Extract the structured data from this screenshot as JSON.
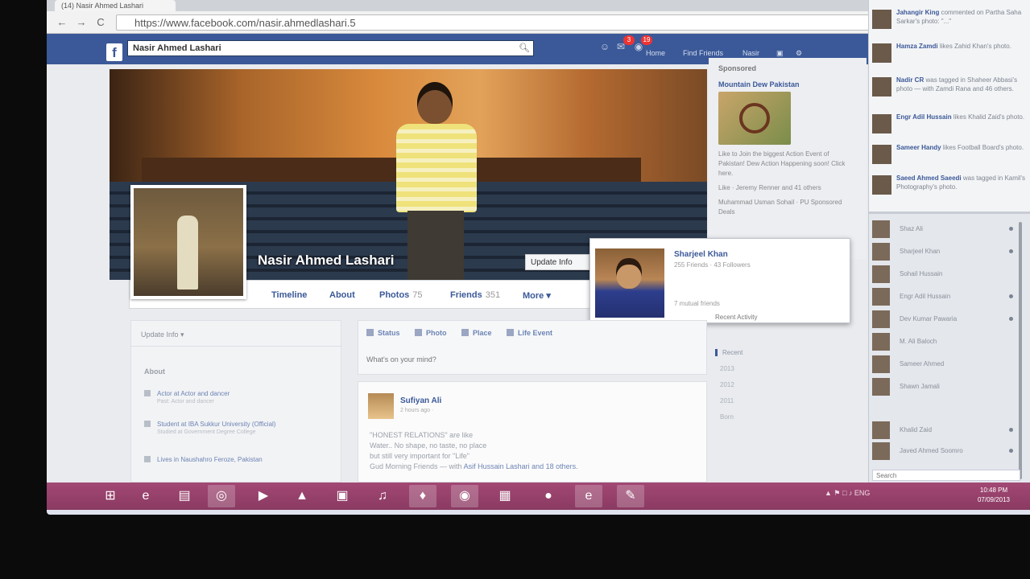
{
  "browser": {
    "tab_title": "(14) Nasir Ahmed Lashari",
    "url": "https://www.facebook.com/nasir.ahmedlashari.5",
    "back": "←",
    "forward": "→",
    "reload": "C"
  },
  "fb_header": {
    "logo": "f",
    "search_value": "Nasir Ahmed Lashari",
    "search_icon": "search-icon",
    "notifications": [
      {
        "icon": "friend-requests-icon",
        "badge": ""
      },
      {
        "icon": "messages-icon",
        "badge": "3"
      },
      {
        "icon": "notifications-icon",
        "badge": "19"
      }
    ],
    "nav": [
      "Home",
      "Find Friends",
      "Nasir"
    ]
  },
  "profile": {
    "name": "Nasir Ahmed Lashari",
    "update_info_label": "Update Info",
    "tabs": [
      {
        "label": "Timeline",
        "count": ""
      },
      {
        "label": "About",
        "count": ""
      },
      {
        "label": "Photos",
        "count": "75"
      },
      {
        "label": "Friends",
        "count": "351"
      },
      {
        "label": "More ▾",
        "count": ""
      }
    ]
  },
  "sponsored": {
    "header": "Sponsored",
    "ad_title": "Mountain Dew Pakistan",
    "ad_desc": "Like to Join the biggest Action Event of Pakistan! Dew Action Happening soon! Click here.",
    "likes": "Like · Jeremy Renner and 41 others",
    "extra": "Muhammad Usman Sohail · PU Sponsored Deals"
  },
  "hovercard": {
    "name": "Sharjeel Khan",
    "sub": "255 Friends · 43 Followers",
    "mutual": "7 mutual friends"
  },
  "left_col": {
    "update_info": "Update Info ▾",
    "about_title": "About",
    "items": [
      {
        "label": "Actor at Actor and dancer",
        "sub": "Past: Actor and dancer"
      },
      {
        "label": "Student at IBA Sukkur University (Official)",
        "sub": "Studied at Government Degree College"
      },
      {
        "label": "Lives in Naushahro Feroze, Pakistan",
        "sub": ""
      }
    ]
  },
  "composer": {
    "tabs": [
      "Status",
      "Photo",
      "Place",
      "Life Event"
    ],
    "placeholder": "What's on your mind?"
  },
  "post": {
    "author": "Sufiyan Ali",
    "time": "2 hours ago · ",
    "line1": "\"HONEST RELATIONS\" are like",
    "line2": "Water.. No shape, no taste, no place",
    "line3": "but still very important for \"Life\"",
    "line4_prefix": "Gud Morning Friends — with ",
    "line4_link": "Asif Hussain Lashari and 18 others."
  },
  "years": {
    "note": "Recent Activity",
    "list": [
      "Recent",
      "2013",
      "2012",
      "2011",
      "Born"
    ]
  },
  "ticker": [
    {
      "actor": "Jahangir King",
      "text": "commented on Partha Saha Sarkar's photo: \"...\""
    },
    {
      "actor": "Hamza Zamdi",
      "text": "likes Zahid Khan's photo."
    },
    {
      "actor": "Nadir CR",
      "text": "was tagged in Shaheer Abbasi's photo — with Zamdi Rana and 46 others."
    },
    {
      "actor": "Engr Adil Hussain",
      "text": "likes Khalid Zaid's photo."
    },
    {
      "actor": "Sameer Handy",
      "text": "likes Football Board's photo."
    },
    {
      "actor": "Saeed Ahmed Saeedi",
      "text": "was tagged in Kamil's Photography's photo."
    }
  ],
  "chat": {
    "friends": [
      "Shaz Ali",
      "Sharjeel Khan",
      "Sohail Hussain",
      "Engr Adil Hussain",
      "Dev Kumar Pawaria",
      "M. Ali Baloch",
      "Sameer Ahmed",
      "Shawn Jamali",
      "Khalid Zaid",
      "Javed Ahmed Soomro"
    ],
    "search_placeholder": "Search"
  },
  "taskbar": {
    "apps": [
      "windows-logo-icon",
      "internet-explorer-icon",
      "file-explorer-icon",
      "disc-icon",
      "media-icon",
      "vlc-icon",
      "network-icon",
      "itunes-icon",
      "game-icon",
      "chrome-icon",
      "office-icon",
      "app-icon",
      "browser-icon",
      "paint-icon"
    ],
    "tray": "ENG",
    "time": "10:48 PM",
    "date": "07/09/2013"
  },
  "colors": {
    "facebook_blue": "#3b5998",
    "taskbar": "#8a3a62",
    "badge_red": "#e33333"
  }
}
